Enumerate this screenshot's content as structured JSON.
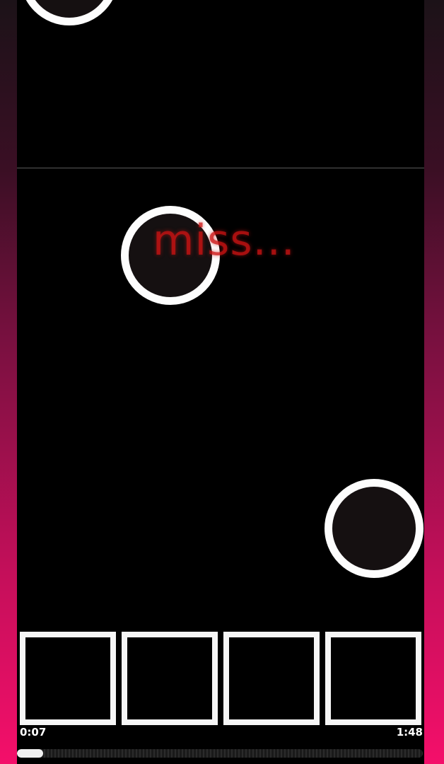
{
  "game": {
    "judgement": "miss...",
    "notes": [
      {
        "id": "note-1",
        "lane": 1
      },
      {
        "id": "note-2",
        "lane": 2
      },
      {
        "id": "note-3",
        "lane": 4
      }
    ],
    "lane_count": 4
  },
  "playback": {
    "elapsed": "0:07",
    "total": "1:48",
    "progress_fraction": 0.065
  },
  "colors": {
    "border_top": "#1c1218",
    "border_bottom": "#f40f6a",
    "note_fill": "#151011",
    "note_ring": "#fdfdfd",
    "judgement": "#cd1414"
  }
}
